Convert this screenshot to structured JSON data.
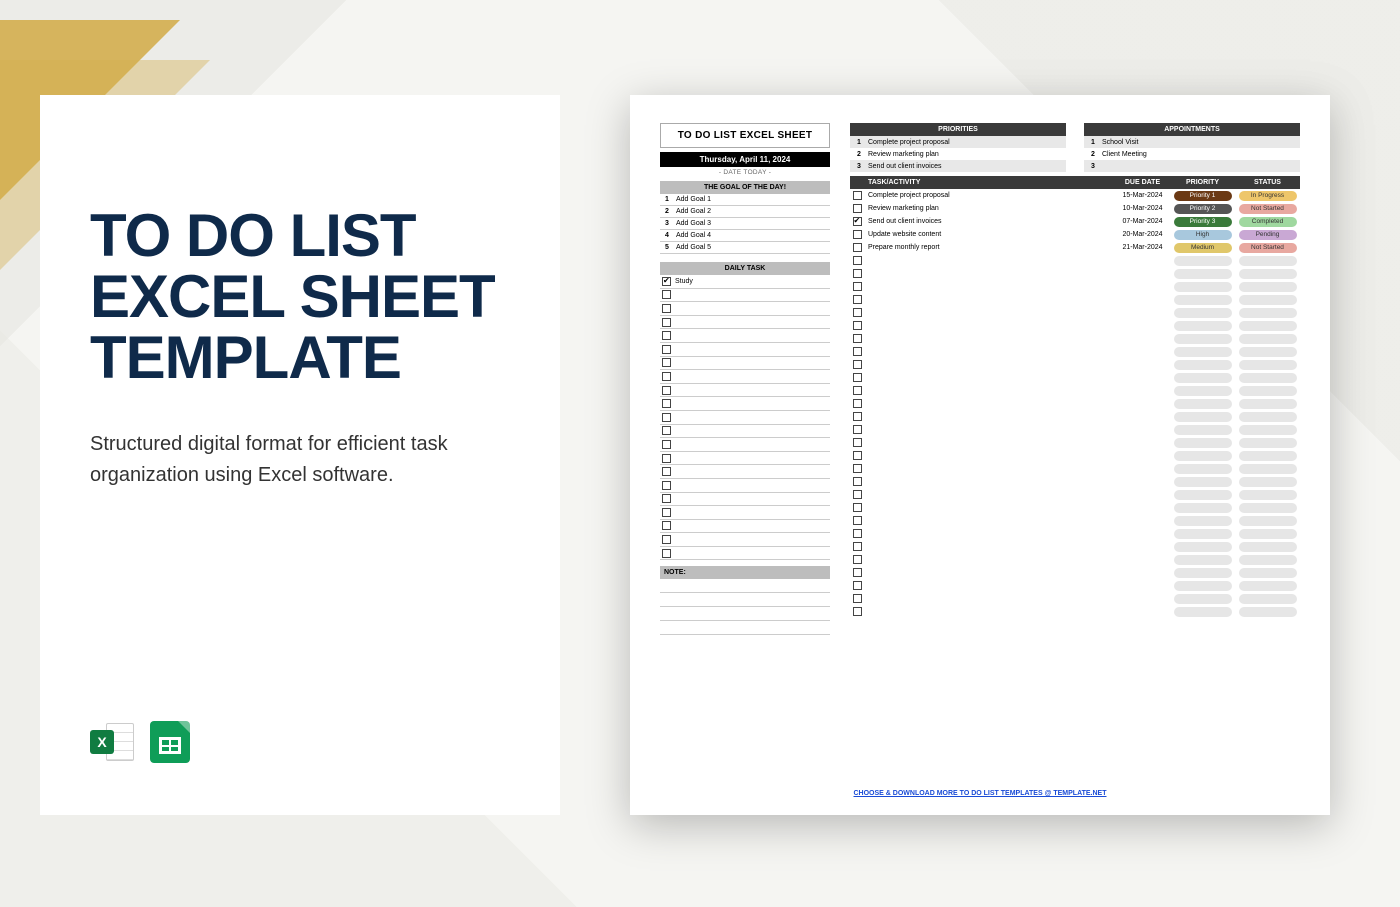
{
  "card": {
    "title_line1": "TO DO LIST",
    "title_line2": "EXCEL SHEET",
    "title_line3": "TEMPLATE",
    "description": "Structured digital format for efficient task organization using Excel software.",
    "icons": {
      "excel": "X"
    }
  },
  "sheet": {
    "title": "TO DO LIST EXCEL SHEET",
    "date": "Thursday, April 11, 2024",
    "date_sub": "- DATE TODAY -",
    "goal_head": "THE GOAL OF THE DAY!",
    "goals": [
      {
        "n": "1",
        "t": "Add Goal 1"
      },
      {
        "n": "2",
        "t": "Add Goal 2"
      },
      {
        "n": "3",
        "t": "Add Goal 3"
      },
      {
        "n": "4",
        "t": "Add Goal 4"
      },
      {
        "n": "5",
        "t": "Add Goal 5"
      }
    ],
    "daily_head": "DAILY TASK",
    "daily": [
      {
        "c": true,
        "t": "Study"
      },
      {
        "c": false,
        "t": ""
      },
      {
        "c": false,
        "t": ""
      },
      {
        "c": false,
        "t": ""
      },
      {
        "c": false,
        "t": ""
      },
      {
        "c": false,
        "t": ""
      },
      {
        "c": false,
        "t": ""
      },
      {
        "c": false,
        "t": ""
      },
      {
        "c": false,
        "t": ""
      },
      {
        "c": false,
        "t": ""
      },
      {
        "c": false,
        "t": ""
      },
      {
        "c": false,
        "t": ""
      },
      {
        "c": false,
        "t": ""
      },
      {
        "c": false,
        "t": ""
      },
      {
        "c": false,
        "t": ""
      },
      {
        "c": false,
        "t": ""
      },
      {
        "c": false,
        "t": ""
      },
      {
        "c": false,
        "t": ""
      },
      {
        "c": false,
        "t": ""
      },
      {
        "c": false,
        "t": ""
      },
      {
        "c": false,
        "t": ""
      }
    ],
    "note_head": "NOTE:",
    "prio_head": "PRIORITIES",
    "priorities": [
      {
        "n": "1",
        "t": "Complete project proposal"
      },
      {
        "n": "2",
        "t": "Review marketing plan"
      },
      {
        "n": "3",
        "t": "Send out client invoices"
      }
    ],
    "appt_head": "APPOINTMENTS",
    "appointments": [
      {
        "n": "1",
        "t": "School Visit"
      },
      {
        "n": "2",
        "t": "Client Meeting"
      },
      {
        "n": "3",
        "t": ""
      }
    ],
    "thead": {
      "task": "TASK/ACTIVITY",
      "due": "DUE DATE",
      "prio": "PRIORITY",
      "stat": "STATUS"
    },
    "tasks": [
      {
        "c": false,
        "t": "Complete project proposal",
        "due": "15-Mar-2024",
        "prio": "Priority 1",
        "prio_cls": "bg-prio1",
        "stat": "In Progress",
        "stat_cls": "bg-inprog"
      },
      {
        "c": false,
        "t": "Review marketing plan",
        "due": "10-Mar-2024",
        "prio": "Priority 2",
        "prio_cls": "bg-prio2",
        "stat": "Not Started",
        "stat_cls": "bg-notstart"
      },
      {
        "c": true,
        "t": "Send out client invoices",
        "due": "07-Mar-2024",
        "prio": "Priority 3",
        "prio_cls": "bg-prio3",
        "stat": "Completed",
        "stat_cls": "bg-complete"
      },
      {
        "c": false,
        "t": "Update website content",
        "due": "20-Mar-2024",
        "prio": "High",
        "prio_cls": "bg-high",
        "stat": "Pending",
        "stat_cls": "bg-pending"
      },
      {
        "c": false,
        "t": "Prepare monthly report",
        "due": "21-Mar-2024",
        "prio": "Medium",
        "prio_cls": "bg-med",
        "stat": "Not Started",
        "stat_cls": "bg-notstart"
      }
    ],
    "empty_rows": 28,
    "footer": "CHOOSE & DOWNLOAD MORE TO DO LIST TEMPLATES  @  TEMPLATE.NET"
  }
}
